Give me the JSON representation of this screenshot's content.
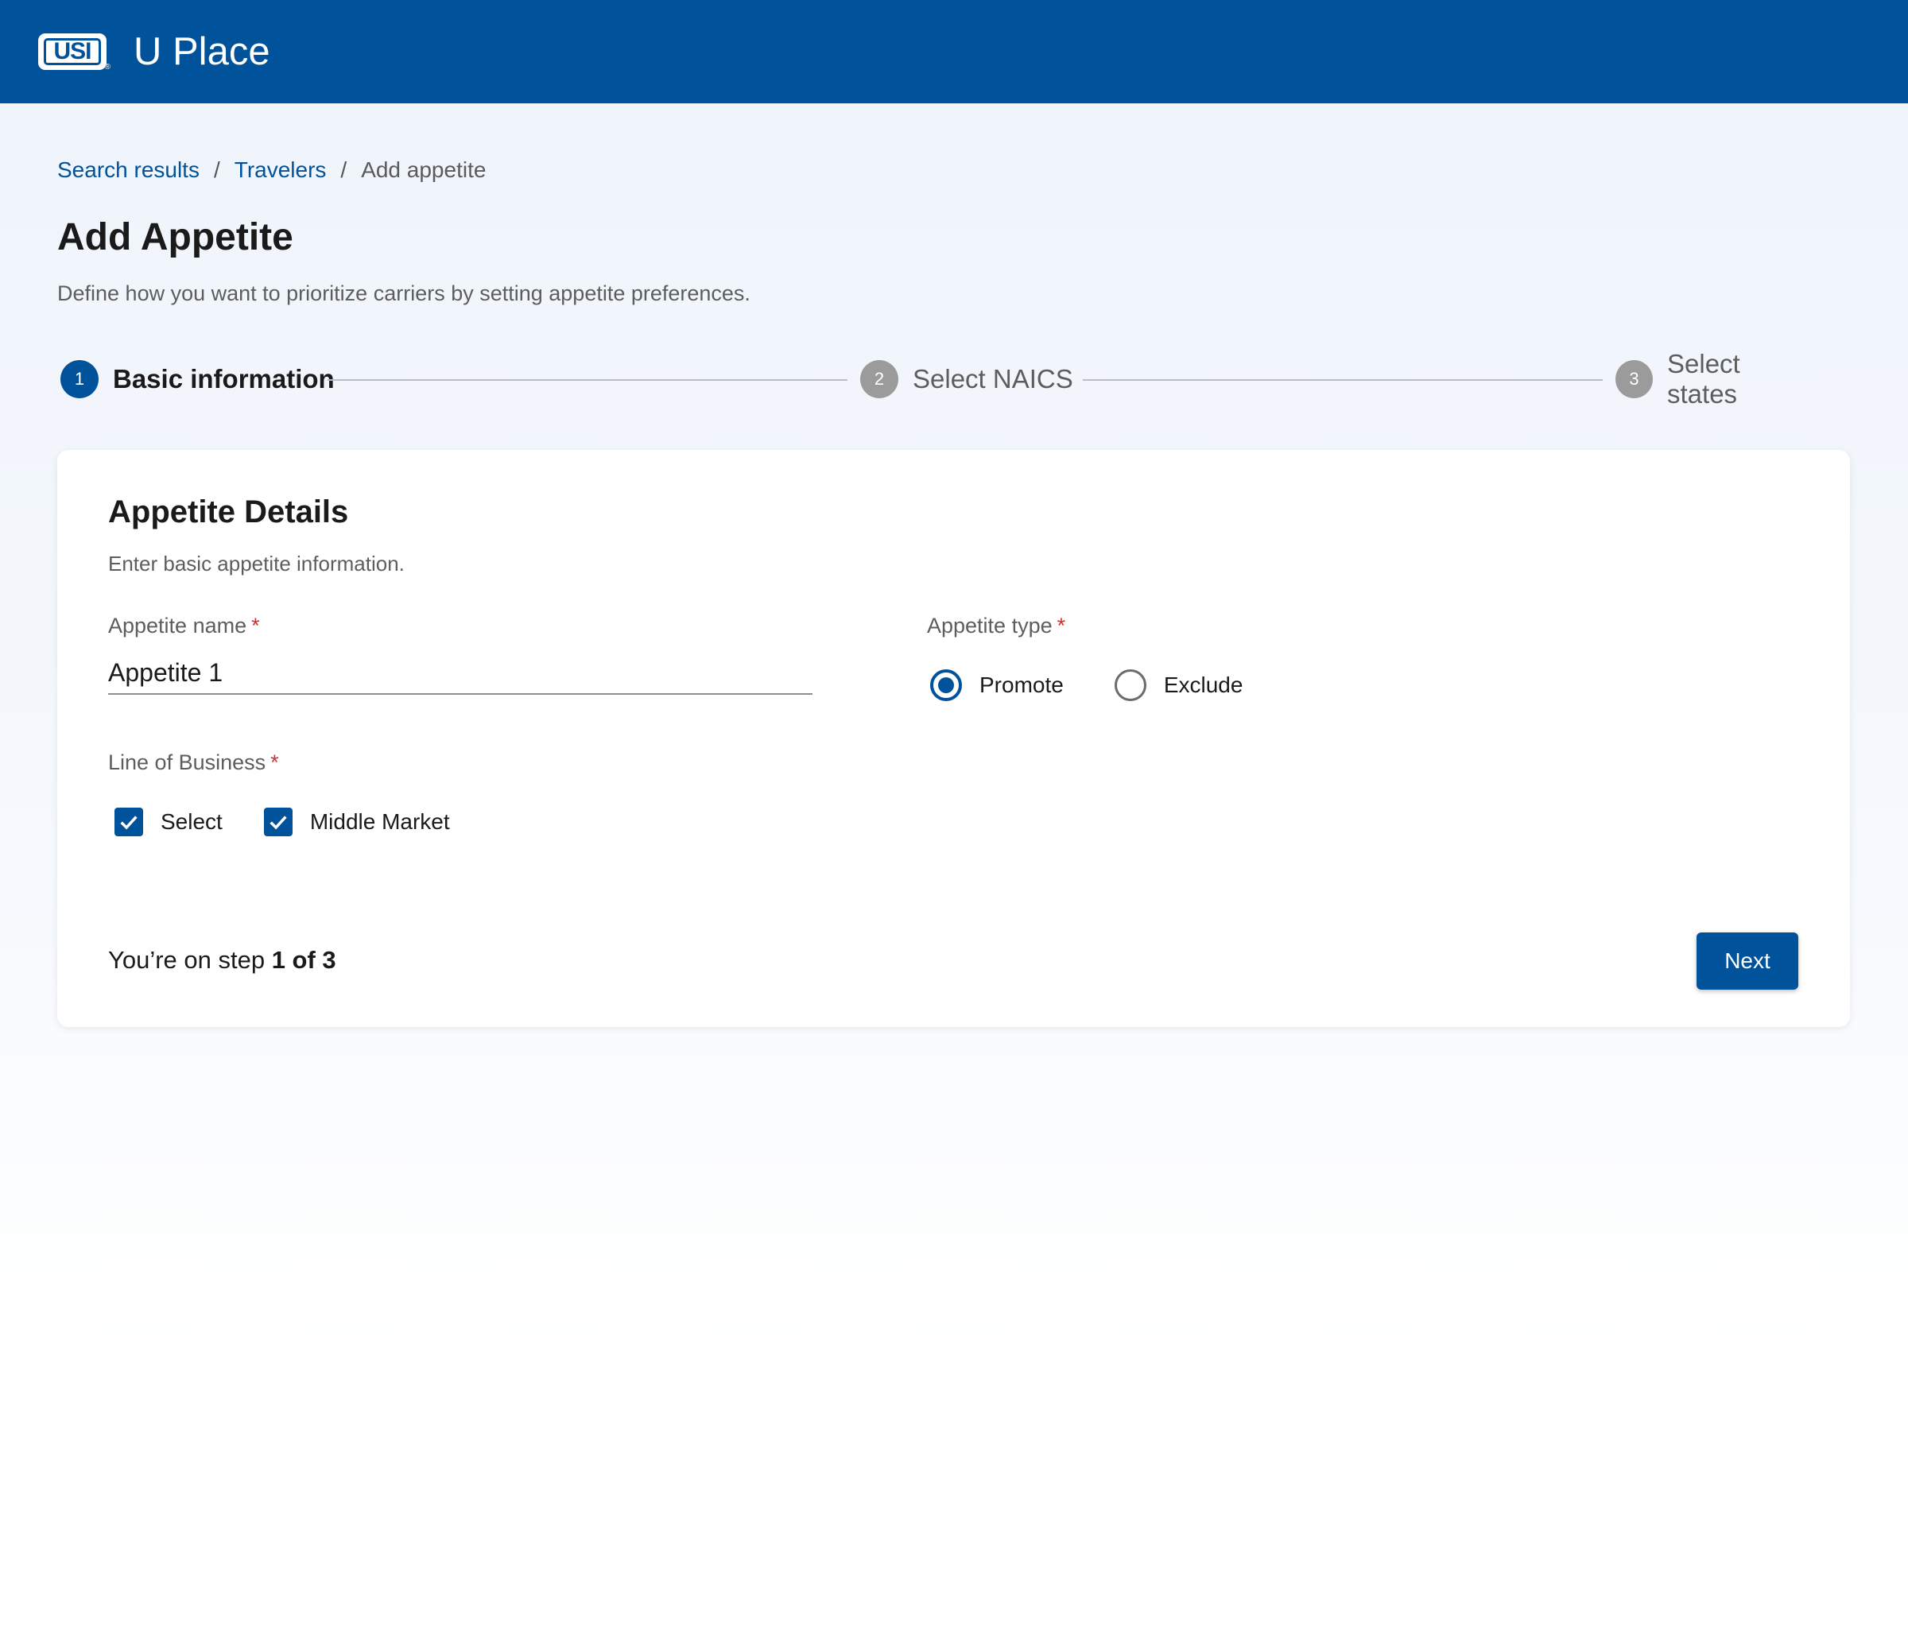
{
  "header": {
    "logo_text": "USI",
    "logo_mark": "®",
    "app_title": "U Place",
    "background_color": "#00529b"
  },
  "breadcrumb": {
    "items": [
      "Search results",
      "Travelers",
      "Add appetite"
    ],
    "separator": "/"
  },
  "page": {
    "title": "Add Appetite",
    "subtitle": "Define how you want to prioritize carriers by setting appetite preferences."
  },
  "stepper": {
    "steps": [
      {
        "number": "1",
        "label": "Basic information",
        "state": "active"
      },
      {
        "number": "2",
        "label": "Select NAICS",
        "state": "inactive"
      },
      {
        "number": "3",
        "label": "Select states",
        "state": "inactive"
      }
    ]
  },
  "card": {
    "title": "Appetite Details",
    "subtitle": "Enter basic appetite information.",
    "required_marker": "*",
    "appetite_name": {
      "label": "Appetite name",
      "value": "Appetite 1"
    },
    "appetite_type": {
      "label": "Appetite type",
      "options": [
        "Promote",
        "Exclude"
      ],
      "selected": "Promote"
    },
    "line_of_business": {
      "label": "Line of Business",
      "options": [
        {
          "label": "Select",
          "checked": true
        },
        {
          "label": "Middle Market",
          "checked": true
        }
      ]
    },
    "footer": {
      "step_prefix": "You’re on step",
      "step_value": "1 of 3",
      "next_label": "Next"
    }
  },
  "colors": {
    "primary": "#00529b",
    "required": "#d32f2f",
    "inactive_step": "#9b9b9b"
  }
}
